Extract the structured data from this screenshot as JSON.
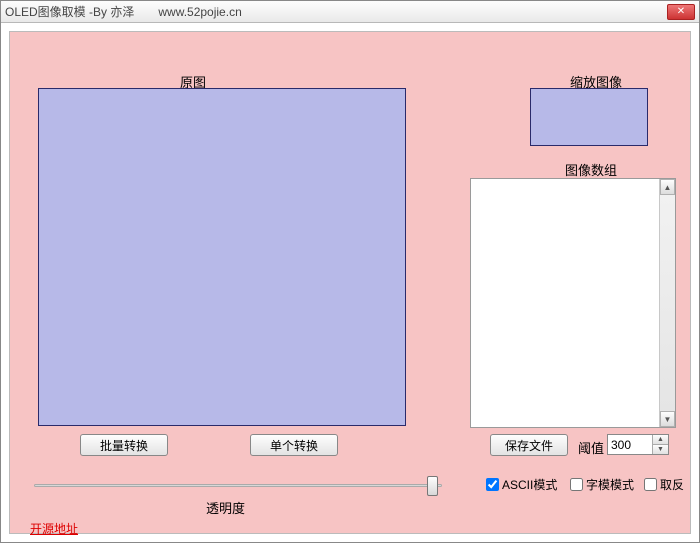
{
  "window": {
    "title": "OLED图像取模  -By 亦泽",
    "url": "www.52pojie.cn"
  },
  "labels": {
    "original": "原图",
    "scaled": "缩放图像",
    "array": "图像数组",
    "opacity": "透明度",
    "threshold": "阈值"
  },
  "buttons": {
    "batch": "批量转换",
    "single": "单个转换",
    "save": "保存文件"
  },
  "inputs": {
    "threshold_value": "300"
  },
  "checkboxes": {
    "ascii": {
      "label": "ASCII模式",
      "checked": true
    },
    "fontmode": {
      "label": "字模模式",
      "checked": false
    },
    "invert": {
      "label": "取反",
      "checked": false
    }
  },
  "link": {
    "opensource": "开源地址"
  }
}
